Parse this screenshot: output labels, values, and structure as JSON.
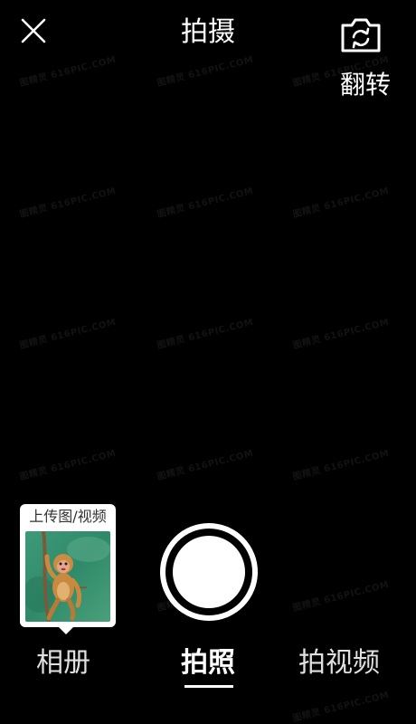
{
  "header": {
    "title": "拍摄",
    "close_icon": "close-icon",
    "flip_icon": "camera-flip-icon",
    "flip_label": "翻转"
  },
  "album_card": {
    "caption": "上传图/视频",
    "thumbnail": "monkey-photo"
  },
  "shutter": {
    "icon": "shutter-button"
  },
  "mode_tabs": [
    {
      "label": "相册",
      "active": false
    },
    {
      "label": "拍照",
      "active": true
    },
    {
      "label": "拍视频",
      "active": false
    }
  ],
  "watermark": {
    "text": "图精灵 616PIC.COM"
  },
  "colors": {
    "background": "#000000",
    "foreground": "#ffffff"
  }
}
